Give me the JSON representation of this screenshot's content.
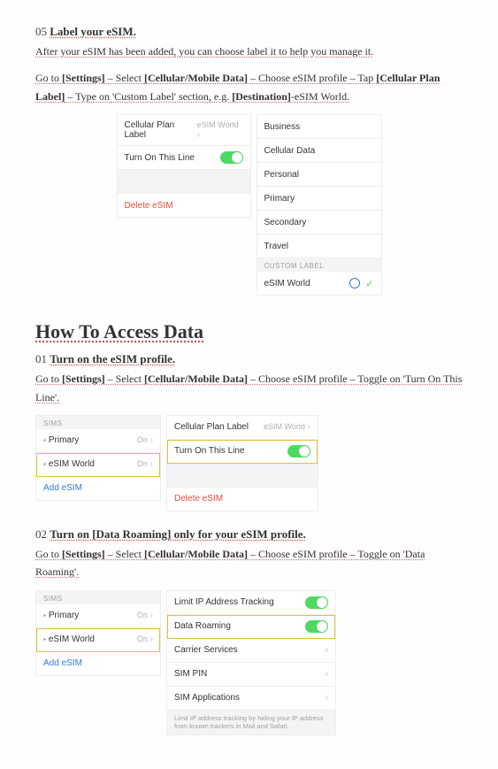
{
  "step05": {
    "num": "05",
    "title": "Label your eSIM.",
    "instr_parts": {
      "p1": "After your eSIM has been added, you can choose label it to help you manage it.",
      "p2a": "Go to ",
      "p2b": "[Settings]",
      "p2c": " – Select ",
      "p2d": "[Cellular/Mobile Data]",
      "p2e": " – Choose eSIM profile – Tap ",
      "p2f": "[Cellular Plan Label]",
      "p2g": " – Type on ",
      "p2h": "'Custom Label'",
      "p2i": " section, e.g. ",
      "p2j": "[Destination]",
      "p2k": "-eSIM World."
    },
    "left_panel": {
      "row1_label": "Cellular Plan Label",
      "row1_value": "eSIM World",
      "row2_label": "Turn On This Line",
      "delete": "Delete eSIM"
    },
    "right_panel": {
      "options": [
        "Business",
        "Cellular Data",
        "Personal",
        "Primary",
        "Secondary",
        "Travel"
      ],
      "custom_header": "CUSTOM LABEL",
      "custom_value": "eSIM World"
    }
  },
  "section_heading": "How To Access Data",
  "step01": {
    "num": "01",
    "title": "Turn on the eSIM profile.",
    "instr": {
      "a": "Go to ",
      "b": "[Settings]",
      "c": " – Select ",
      "d": "[Cellular/Mobile Data]",
      "e": " – Choose eSIM profile – Toggle on ",
      "f": "'Turn On This Line'"
    },
    "sims_panel": {
      "header": "SIMs",
      "primary": "Primary",
      "on": "On",
      "esim": "eSIM World",
      "add": "Add eSIM"
    },
    "right_panel": {
      "row1_label": "Cellular Plan Label",
      "row1_value": "eSIM World",
      "row2_label": "Turn On This Line",
      "delete": "Delete eSIM"
    }
  },
  "step02": {
    "num": "02",
    "title": "Turn on [Data Roaming] only for your eSIM profile.",
    "instr": {
      "a": "Go to ",
      "b": "[Settings]",
      "c": " – Select ",
      "d": "[Cellular/Mobile Data]",
      "e": " – Choose eSIM profile – Toggle on ",
      "f": "'Data Roaming'"
    },
    "sims_panel": {
      "header": "SIMs",
      "primary": "Primary",
      "on": "On",
      "esim": "eSIM World",
      "add": "Add eSIM"
    },
    "right_panel": {
      "r1": "Limit IP Address Tracking",
      "r2": "Data Roaming",
      "r3": "Carrier Services",
      "r4": "SIM PIN",
      "r5": "SIM Applications",
      "foot": "Limit IP address tracking by hiding your IP address from known trackers in Mail and Safari."
    }
  }
}
